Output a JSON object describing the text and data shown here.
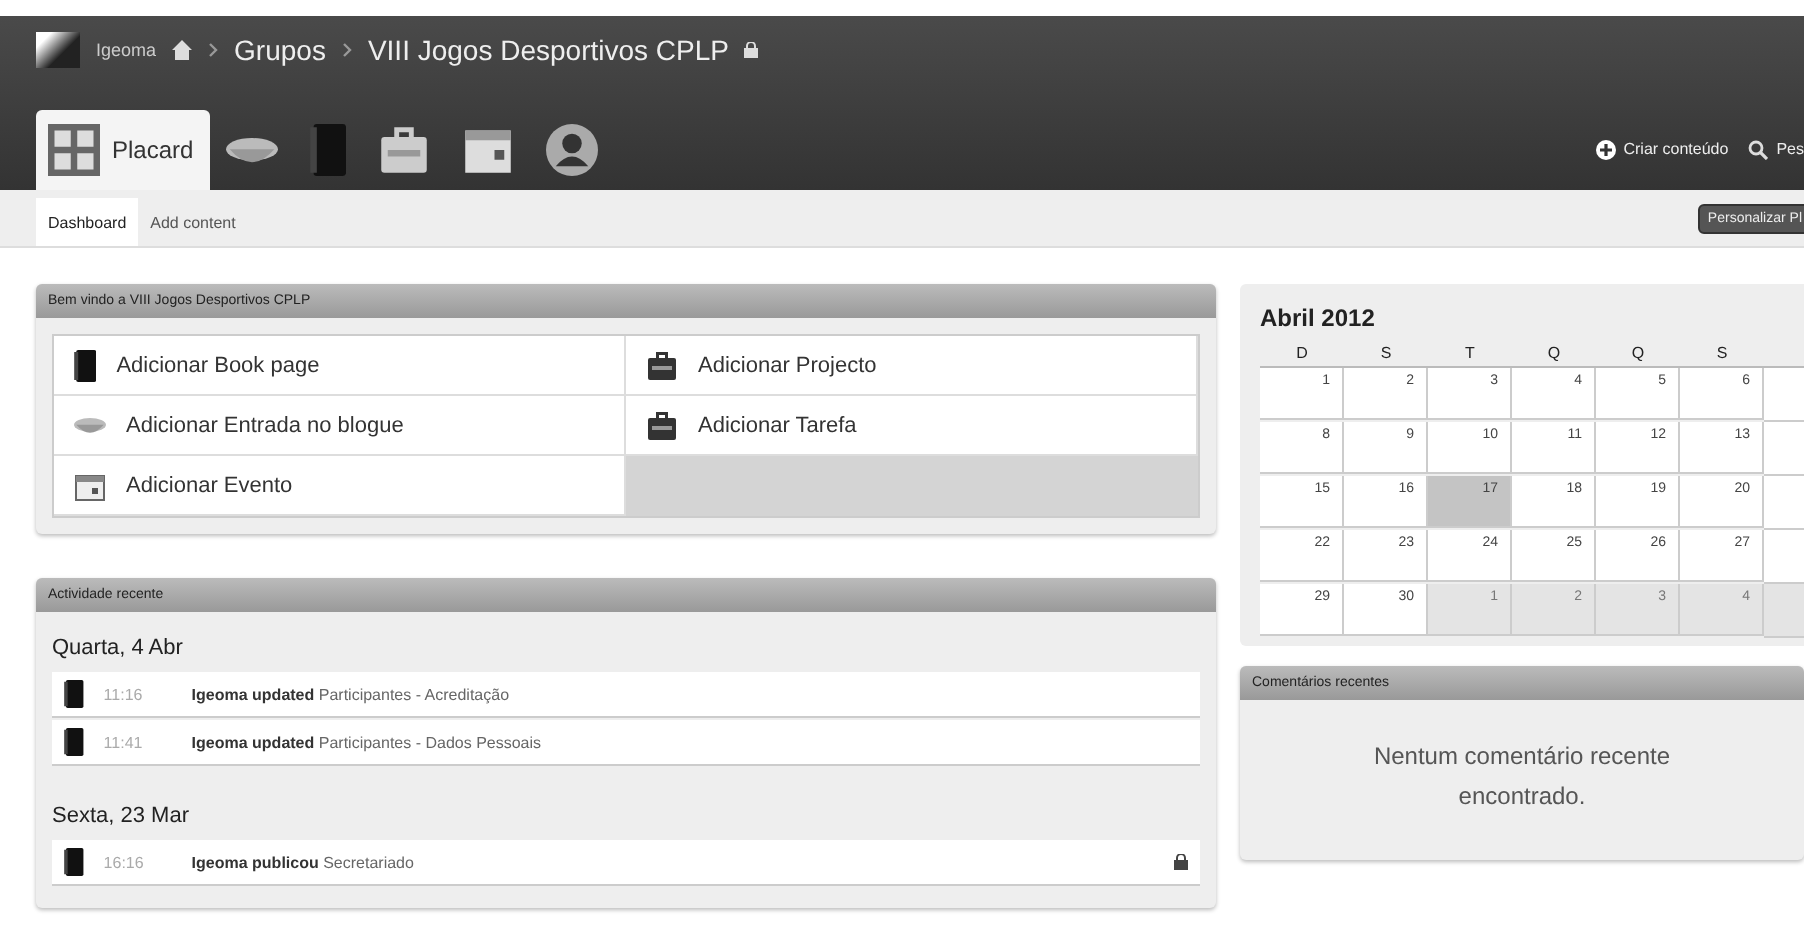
{
  "header": {
    "user": "Igeoma",
    "breadcrumb": [
      "Grupos",
      "VIII Jogos Desportivos CPLP"
    ],
    "actions": [
      {
        "kind": "create",
        "label": "Criar conteúdo"
      },
      {
        "kind": "search",
        "label": "Pes"
      }
    ]
  },
  "tabs": [
    {
      "kind": "dashboard",
      "label": "Placard",
      "selected": true
    },
    {
      "kind": "blog",
      "selected": false
    },
    {
      "kind": "book",
      "selected": false
    },
    {
      "kind": "project",
      "selected": false
    },
    {
      "kind": "calendar",
      "selected": false
    },
    {
      "kind": "people",
      "selected": false
    }
  ],
  "subtabs": [
    {
      "label": "Dashboard",
      "selected": true
    },
    {
      "label": "Add content",
      "selected": false
    }
  ],
  "customize_button": "Personalizar Pl",
  "welcome": {
    "title": "Bem vindo a VIII Jogos Desportivos CPLP",
    "items": [
      {
        "kind": "book",
        "label": "Adicionar Book page"
      },
      {
        "kind": "project",
        "label": "Adicionar Projecto"
      },
      {
        "kind": "blog",
        "label": "Adicionar Entrada no blogue"
      },
      {
        "kind": "project",
        "label": "Adicionar Tarefa"
      },
      {
        "kind": "event",
        "label": "Adicionar Evento"
      }
    ]
  },
  "activity": {
    "title": "Actividade recente",
    "days": [
      {
        "date": "Quarta, 4 Abr",
        "entries": [
          {
            "time": "11:16",
            "text": "**Igeoma updated** Participantes - Acreditação",
            "locked": false
          },
          {
            "time": "11:41",
            "text": "**Igeoma updated** Participantes - Dados Pessoais",
            "locked": false
          }
        ]
      },
      {
        "date": "Sexta, 23 Mar",
        "entries": [
          {
            "time": "16:16",
            "text": "**Igeoma publicou** Secretariado",
            "locked": true
          }
        ]
      }
    ]
  },
  "calendar": {
    "title": "Abril 2012",
    "weekdays": [
      "D",
      "S",
      "T",
      "Q",
      "Q",
      "S"
    ],
    "weeks": [
      [
        {
          "day": "1",
          "other_month": false,
          "selected": false
        },
        {
          "day": "2",
          "other_month": false,
          "selected": false
        },
        {
          "day": "3",
          "other_month": false,
          "selected": false
        },
        {
          "day": "4",
          "other_month": false,
          "selected": false
        },
        {
          "day": "5",
          "other_month": false,
          "selected": false
        },
        {
          "day": "6",
          "other_month": false,
          "selected": false
        }
      ],
      [
        {
          "day": "8",
          "other_month": false,
          "selected": false
        },
        {
          "day": "9",
          "other_month": false,
          "selected": false
        },
        {
          "day": "10",
          "other_month": false,
          "selected": false
        },
        {
          "day": "11",
          "other_month": false,
          "selected": false
        },
        {
          "day": "12",
          "other_month": false,
          "selected": false
        },
        {
          "day": "13",
          "other_month": false,
          "selected": false
        }
      ],
      [
        {
          "day": "15",
          "other_month": false,
          "selected": false
        },
        {
          "day": "16",
          "other_month": false,
          "selected": false
        },
        {
          "day": "17",
          "other_month": false,
          "selected": true
        },
        {
          "day": "18",
          "other_month": false,
          "selected": false
        },
        {
          "day": "19",
          "other_month": false,
          "selected": false
        },
        {
          "day": "20",
          "other_month": false,
          "selected": false
        }
      ],
      [
        {
          "day": "22",
          "other_month": false,
          "selected": false
        },
        {
          "day": "23",
          "other_month": false,
          "selected": false
        },
        {
          "day": "24",
          "other_month": false,
          "selected": false
        },
        {
          "day": "25",
          "other_month": false,
          "selected": false
        },
        {
          "day": "26",
          "other_month": false,
          "selected": false
        },
        {
          "day": "27",
          "other_month": false,
          "selected": false
        }
      ],
      [
        {
          "day": "29",
          "other_month": false,
          "selected": false
        },
        {
          "day": "30",
          "other_month": false,
          "selected": false
        },
        {
          "day": "1",
          "other_month": true,
          "selected": false
        },
        {
          "day": "2",
          "other_month": true,
          "selected": false
        },
        {
          "day": "3",
          "other_month": true,
          "selected": false
        },
        {
          "day": "4",
          "other_month": true,
          "selected": false
        }
      ]
    ]
  },
  "comments": {
    "title": "Comentários recentes",
    "empty": "Nentum comentário recente encontrado."
  }
}
